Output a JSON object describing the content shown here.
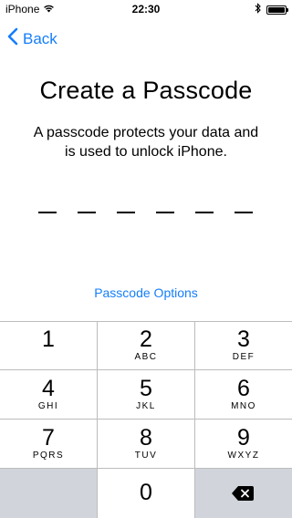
{
  "status": {
    "carrier": "iPhone",
    "time": "22:30"
  },
  "nav": {
    "back_label": "Back"
  },
  "main": {
    "title": "Create a Passcode",
    "subtitle": "A passcode protects your data and is used to unlock iPhone.",
    "passcode_length": 6,
    "entered_digits": 0,
    "options_label": "Passcode Options"
  },
  "keypad": {
    "keys": [
      {
        "digit": "1",
        "letters": ""
      },
      {
        "digit": "2",
        "letters": "ABC"
      },
      {
        "digit": "3",
        "letters": "DEF"
      },
      {
        "digit": "4",
        "letters": "GHI"
      },
      {
        "digit": "5",
        "letters": "JKL"
      },
      {
        "digit": "6",
        "letters": "MNO"
      },
      {
        "digit": "7",
        "letters": "PQRS"
      },
      {
        "digit": "8",
        "letters": "TUV"
      },
      {
        "digit": "9",
        "letters": "WXYZ"
      },
      {
        "digit": "0",
        "letters": ""
      }
    ]
  },
  "colors": {
    "accent": "#157efb",
    "keypad_gray": "#d1d5db"
  },
  "icons": [
    "wifi-icon",
    "bluetooth-icon",
    "battery-icon",
    "chevron-left-icon",
    "delete-backspace-icon"
  ]
}
